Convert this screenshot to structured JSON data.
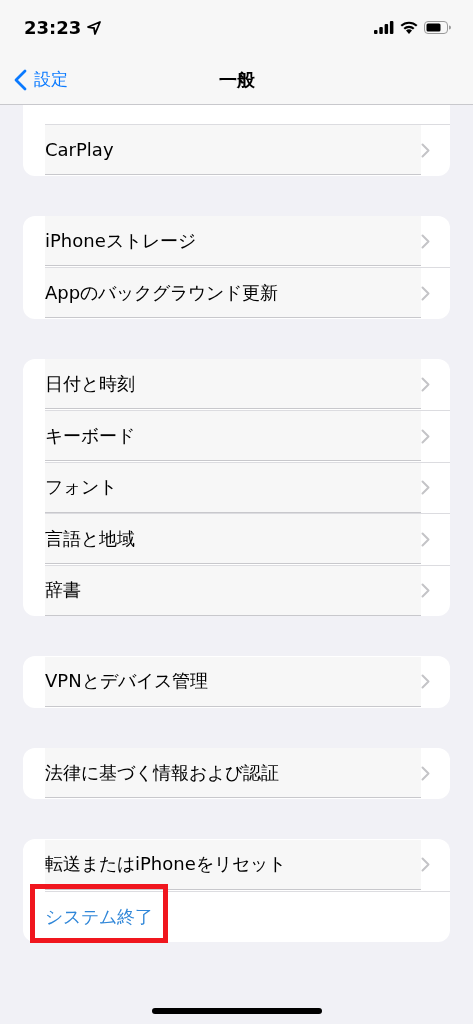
{
  "status_bar": {
    "time": "23:23"
  },
  "nav_bar": {
    "back_label": "設定",
    "title": "一般"
  },
  "groups": [
    {
      "rows": [
        {
          "label": "CarPlay",
          "kind": "nav",
          "highlighted": false
        }
      ]
    },
    {
      "rows": [
        {
          "label": "iPhoneストレージ",
          "kind": "nav",
          "highlighted": false
        },
        {
          "label": "Appのバックグラウンド更新",
          "kind": "nav",
          "highlighted": false
        }
      ]
    },
    {
      "rows": [
        {
          "label": "日付と時刻",
          "kind": "nav",
          "highlighted": false
        },
        {
          "label": "キーボード",
          "kind": "nav",
          "highlighted": false
        },
        {
          "label": "フォント",
          "kind": "nav",
          "highlighted": false
        },
        {
          "label": "言語と地域",
          "kind": "nav",
          "highlighted": false
        },
        {
          "label": "辞書",
          "kind": "nav",
          "highlighted": false
        }
      ]
    },
    {
      "rows": [
        {
          "label": "VPNとデバイス管理",
          "kind": "nav",
          "highlighted": false
        }
      ]
    },
    {
      "rows": [
        {
          "label": "法律に基づく情報および認証",
          "kind": "nav",
          "highlighted": false
        }
      ]
    },
    {
      "rows": [
        {
          "label": "転送またはiPhoneをリセット",
          "kind": "nav",
          "highlighted": false
        },
        {
          "label": "システム終了",
          "kind": "action",
          "highlighted": true
        }
      ]
    }
  ]
}
